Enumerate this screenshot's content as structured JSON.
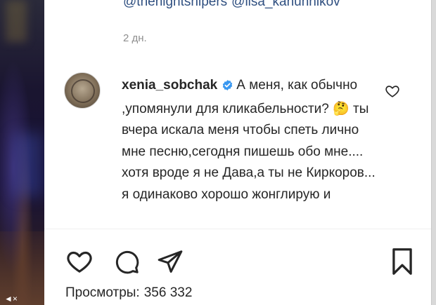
{
  "caption": {
    "mentions": [
      "@thenightsnipers",
      "@lisa_kanunnikov"
    ],
    "timestamp": "2 дн."
  },
  "comment": {
    "username": "xenia_sobchak",
    "verified": true,
    "text": "А меня, как обычно ,упомянули для кликабельности? 🤔 ты вчера искала меня чтобы спеть лично мне песню,сегодня пишешь обо мне.... хотя вроде я не Дава,а ты не Киркоров... я одинаково хорошо жонглирую и"
  },
  "actions": {
    "icons": [
      "heart-icon",
      "comment-icon",
      "share-icon",
      "bookmark-icon"
    ]
  },
  "views": {
    "label": "Просмотры:",
    "count": "356 332"
  },
  "colors": {
    "link": "#2f4f80",
    "verified": "#3897f0",
    "text": "#262626",
    "muted": "#8e8e8e"
  }
}
